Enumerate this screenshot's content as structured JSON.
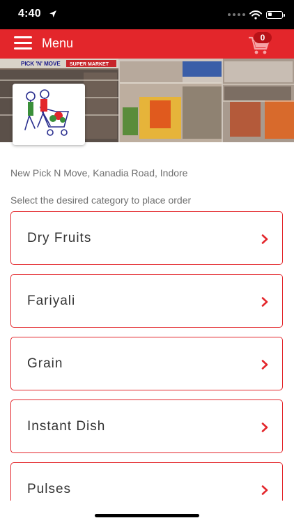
{
  "status_bar": {
    "time": "4:40",
    "battery_level": 0.3
  },
  "app_bar": {
    "menu_label": "Menu",
    "cart_count": "0"
  },
  "banner": {
    "shop_sign": "PICK 'N' MOVE",
    "shop_sign_2": "SUPER MARKET"
  },
  "store": {
    "address": "New Pick N Move, Kanadia Road, Indore"
  },
  "instruction": "Select the desired category to place order",
  "categories": [
    {
      "label": "Dry Fruits"
    },
    {
      "label": "Fariyali"
    },
    {
      "label": "Grain"
    },
    {
      "label": "Instant Dish"
    },
    {
      "label": "Pulses"
    }
  ],
  "colors": {
    "brand_red": "#e3262b",
    "text_gray": "#6f6f6f"
  }
}
